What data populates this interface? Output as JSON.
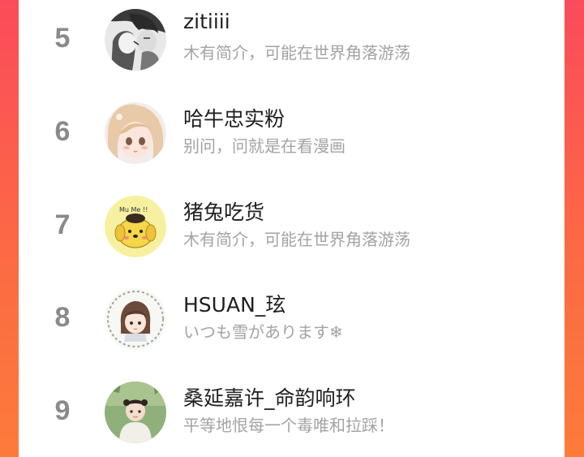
{
  "ranking": {
    "items": [
      {
        "rank": "5",
        "name": "zitiiii",
        "bio": "木有简介，可能在世界角落游荡",
        "avatar": "manga-couple-avatar"
      },
      {
        "rank": "6",
        "name": "哈牛忠实粉",
        "bio": "别问，问就是在看漫画",
        "avatar": "anime-girl-avatar"
      },
      {
        "rank": "7",
        "name": "猪兔吃货",
        "bio": "木有简介，可能在世界角落游荡",
        "avatar": "yellow-dog-avatar"
      },
      {
        "rank": "8",
        "name": "HSUAN_玹",
        "bio": "いつも雪があります❄",
        "avatar": "chibi-girl-avatar"
      },
      {
        "rank": "9",
        "name": "桑延嘉许_命韵响环",
        "bio": "平等地恨每一个毒唯和拉踩！",
        "avatar": "child-photo-avatar"
      }
    ]
  },
  "colors": {
    "frame_top": "#fb4b5a",
    "frame_bottom": "#fd7b3a",
    "rank": "#8a8a8a",
    "name": "#1f1f1f",
    "bio": "#a3a3a3"
  }
}
